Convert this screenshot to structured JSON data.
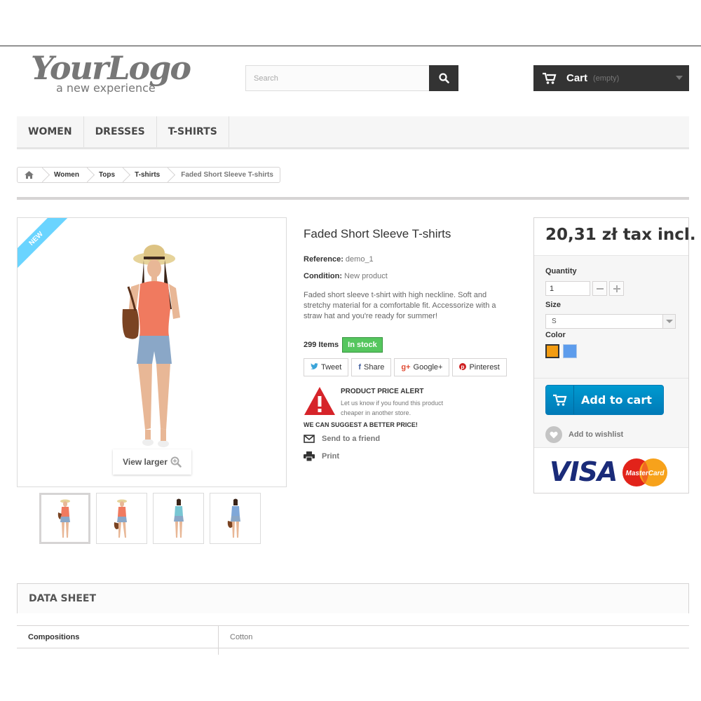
{
  "header": {
    "logo_main": "YourLogo",
    "logo_sub": "a new experience",
    "search_placeholder": "Search",
    "cart_label": "Cart",
    "cart_status": "(empty)"
  },
  "menu": [
    {
      "label": "WOMEN"
    },
    {
      "label": "DRESSES"
    },
    {
      "label": "T-SHIRTS"
    }
  ],
  "breadcrumb": {
    "items": [
      "Women",
      "Tops",
      "T-shirts"
    ],
    "current": "Faded Short Sleeve T-shirts"
  },
  "gallery": {
    "badge": "NEW",
    "view_larger": "View larger",
    "thumb_count": 4
  },
  "product": {
    "title": "Faded Short Sleeve T-shirts",
    "reference_label": "Reference:",
    "reference_value": "demo_1",
    "condition_label": "Condition:",
    "condition_value": "New product",
    "description": "Faded short sleeve t-shirt with high neckline. Soft and stretchy material for a comfortable fit. Accessorize with a straw hat and you're ready for summer!",
    "items_count": "299 Items",
    "stock": "In stock"
  },
  "social": [
    {
      "icon": "twitter-icon",
      "glyph": "🐦",
      "label": "Tweet",
      "color": "#3aa4d9"
    },
    {
      "icon": "facebook-icon",
      "glyph": "f",
      "label": "Share",
      "color": "#435f9f"
    },
    {
      "icon": "googleplus-icon",
      "glyph": "g+",
      "label": "Google+",
      "color": "#e04b33"
    },
    {
      "icon": "pinterest-icon",
      "glyph": "P",
      "label": "Pinterest",
      "color": "#ce1f21"
    }
  ],
  "alert": {
    "title": "PRODUCT PRICE ALERT",
    "text": "Let us know if you found this product cheaper in another store.",
    "suggest": "WE CAN SUGGEST A BETTER PRICE!"
  },
  "links": {
    "send_friend": "Send to a friend",
    "print": "Print"
  },
  "buy": {
    "price": "20,31 zł tax incl.",
    "quantity_label": "Quantity",
    "quantity_value": "1",
    "size_label": "Size",
    "size_value": "S",
    "color_label": "Color",
    "colors": [
      "#f39c11",
      "#5d9cec"
    ],
    "add_to_cart": "Add to cart",
    "wishlist": "Add to wishlist",
    "card_visa": "VISA",
    "card_mc": "MasterCard"
  },
  "datasheet": {
    "title": "DATA SHEET",
    "rows": [
      {
        "key": "Compositions",
        "value": "Cotton"
      }
    ]
  },
  "colors": {
    "dark": "#333333",
    "accent_blue": "#009ad0",
    "stock_green": "#55c65e",
    "alert_red": "#d6242a",
    "ribbon": "#6ad4ff"
  }
}
